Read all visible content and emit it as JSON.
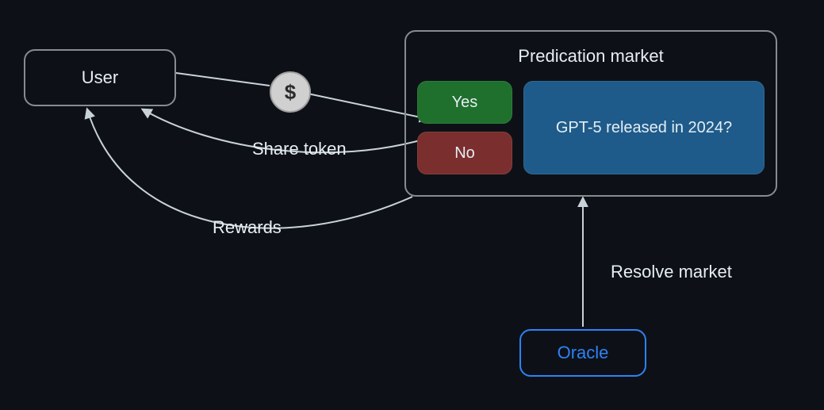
{
  "nodes": {
    "user": {
      "label": "User"
    },
    "oracle": {
      "label": "Oracle"
    }
  },
  "market": {
    "title": "Predication market",
    "yes_label": "Yes",
    "no_label": "No",
    "question": "GPT-5 released in 2024?"
  },
  "edges": {
    "pay_symbol": "$",
    "share_token_label": "Share token",
    "rewards_label": "Rewards",
    "resolve_label": "Resolve market"
  },
  "colors": {
    "bg": "#0d1117",
    "stroke": "#888b90",
    "text": "#e6edf3",
    "oracle": "#2f81f7",
    "yes": "#1f6f2d",
    "no": "#7a2e2d",
    "question_bg": "#1e5b8a"
  }
}
